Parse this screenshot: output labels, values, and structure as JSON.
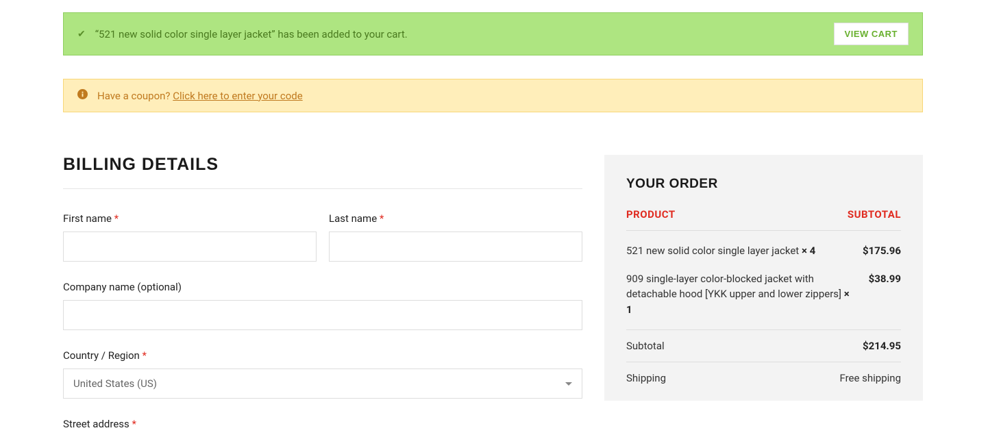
{
  "alerts": {
    "success_msg": "“521 new solid color single layer jacket” has been added to your cart.",
    "view_cart_btn": "VIEW CART",
    "coupon_prompt": "Have a coupon? ",
    "coupon_link": "Click here to enter your code"
  },
  "billing": {
    "title": "BILLING DETAILS",
    "first_name_label": "First name ",
    "last_name_label": "Last name ",
    "company_label": "Company name (optional)",
    "country_label": "Country / Region ",
    "country_value": "United States (US)",
    "street_label": "Street address ",
    "required": "*"
  },
  "order": {
    "title": "YOUR ORDER",
    "head_product": "PRODUCT",
    "head_subtotal": "SUBTOTAL",
    "items": [
      {
        "name": "521 new solid color single layer jacket  ",
        "qty": "× 4",
        "price": "$175.96"
      },
      {
        "name": "909 single-layer color-blocked jacket with detachable hood [YKK upper and lower zippers]  ",
        "qty": "× 1",
        "price": "$38.99"
      }
    ],
    "subtotal_label": "Subtotal",
    "subtotal_value": "$214.95",
    "shipping_label": "Shipping",
    "shipping_value": "Free shipping"
  }
}
